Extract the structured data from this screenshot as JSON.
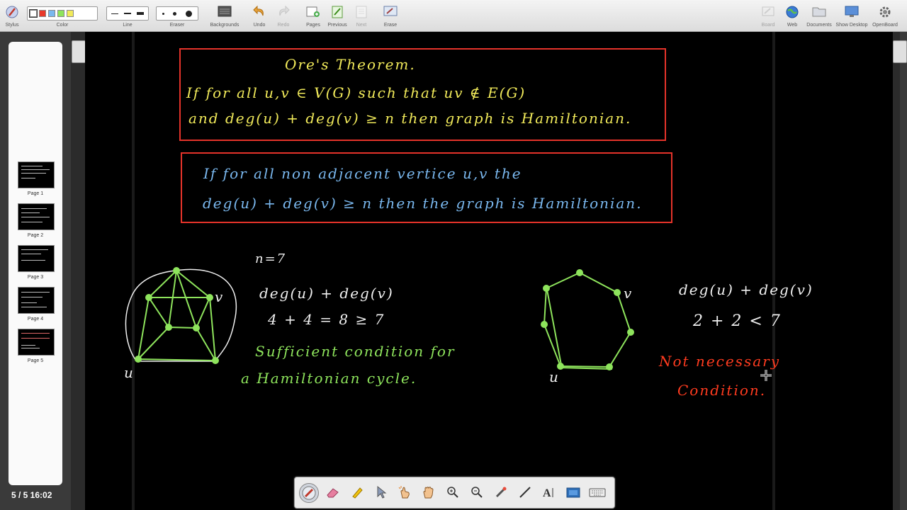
{
  "toolbar": {
    "left": [
      {
        "label": "Stylus"
      },
      {
        "label": "Color"
      },
      {
        "label": "Line"
      },
      {
        "label": "Eraser"
      },
      {
        "label": "Backgrounds"
      },
      {
        "label": "Undo"
      },
      {
        "label": "Redo"
      },
      {
        "label": "Pages"
      },
      {
        "label": "Previous"
      },
      {
        "label": "Next"
      },
      {
        "label": "Erase"
      }
    ],
    "right": [
      {
        "label": "Board"
      },
      {
        "label": "Web"
      },
      {
        "label": "Documents"
      },
      {
        "label": "Show Desktop"
      },
      {
        "label": "OpenBoard"
      }
    ],
    "colors": [
      "#ffffff",
      "#e8392b",
      "#7ab8ef",
      "#8ee45c",
      "#f1ea5a"
    ]
  },
  "pages": {
    "items": [
      {
        "label": "Page 1"
      },
      {
        "label": "Page 2"
      },
      {
        "label": "Page 3"
      },
      {
        "label": "Page 4"
      },
      {
        "label": "Page 5"
      }
    ],
    "status": "5 / 5  16:02"
  },
  "board": {
    "box1": {
      "title": "Ore's Theorem.",
      "line1": "If  for  all   u,v  ∈ V(G)  such that  uv ∉ E(G)",
      "line2": "and  deg(u) + deg(v) ≥ n   then  graph is Hamiltonian."
    },
    "box2": {
      "line1": "If  for all  non adjacent  vertice  u,v  the",
      "line2": "deg(u) + deg(v) ≥ n    then  the  graph  is  Hamiltonian."
    },
    "left_graph": {
      "u_label": "u",
      "v_label": "v"
    },
    "n_eq": "n=7",
    "deg_sum": "deg(u) + deg(v)",
    "deg_vals": "4    +    4  = 8  ≥ 7",
    "sufficient_1": "Sufficient  condition  for",
    "sufficient_2": "a  Hamiltonian  cycle.",
    "right_graph": {
      "u_label": "u",
      "v_label": "v"
    },
    "deg_sum_2": "deg(u) + deg(v)",
    "deg_vals_2": "2 + 2 < 7",
    "not_necessary_1": "Not   necessary",
    "not_necessary_2": "Condition."
  },
  "dock": {
    "tools": [
      "pen-tool",
      "eraser-tool",
      "marker-tool",
      "selector-tool",
      "interactor-tool",
      "hand-tool",
      "zoom-in-tool",
      "zoom-out-tool",
      "laser-pointer-tool",
      "line-tool",
      "text-tool",
      "capture-tool",
      "virtual-keyboard-tool"
    ]
  }
}
